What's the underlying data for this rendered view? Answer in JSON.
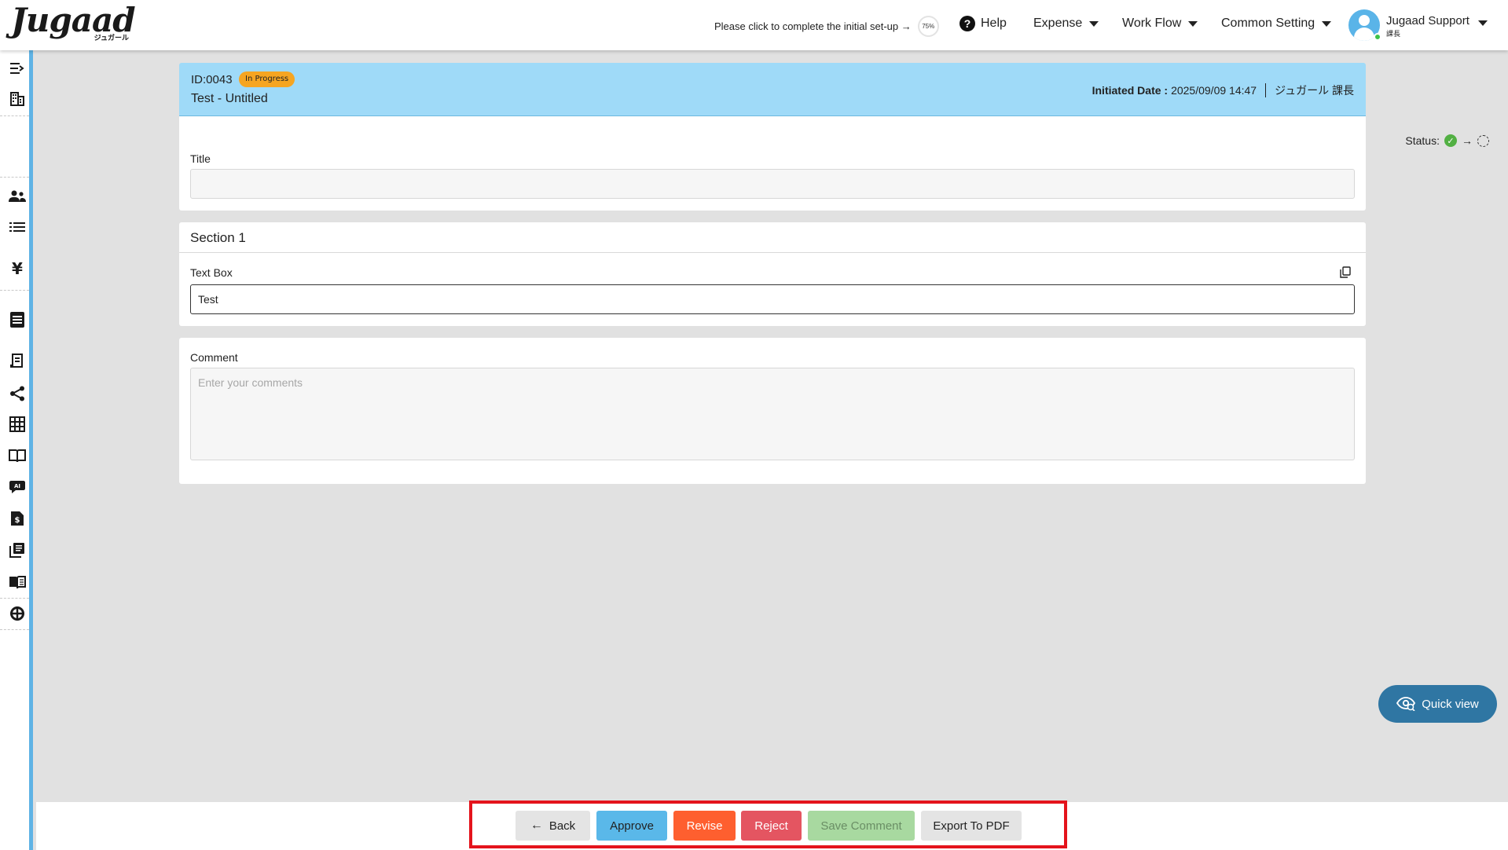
{
  "header": {
    "logo_text": "Jugaad",
    "logo_sub": "ジュガール",
    "setup_prompt": "Please click to complete the initial set-up →",
    "setup_progress": "75%",
    "help_label": "Help",
    "menus": [
      "Expense",
      "Work Flow",
      "Common Setting"
    ],
    "user_name": "Jugaad Support",
    "user_role": "課長"
  },
  "sidebar": {
    "icons": [
      "expand-sidebar-icon",
      "building-icon",
      "users-icon",
      "list-icon",
      "yen-icon",
      "document-icon",
      "receipt-icon",
      "share-icon",
      "grid-icon",
      "book-icon",
      "ai-chat-icon",
      "invoice-icon",
      "library-icon",
      "manual-icon",
      "support-icon"
    ]
  },
  "request": {
    "id": "ID:0043",
    "status_badge": "In Progress",
    "title": "Test - Untitled",
    "initiated_label": "Initiated Date :",
    "initiated_date": "2025/09/09 14:47",
    "initiator": "ジュガール 課長",
    "status_label": "Status:"
  },
  "form": {
    "title_label": "Title",
    "title_value": "",
    "section_title": "Section 1",
    "textbox_label": "Text Box",
    "textbox_value": "Test",
    "comment_label": "Comment",
    "comment_placeholder": "Enter your comments"
  },
  "quick_view_label": "Quick view",
  "actions": {
    "back": "Back",
    "approve": "Approve",
    "revise": "Revise",
    "reject": "Reject",
    "save_comment": "Save Comment",
    "export_pdf": "Export To PDF"
  },
  "colors": {
    "accent_blue": "#5ab8e9",
    "header_band": "#9fdaf8",
    "badge_orange": "#f6a521",
    "revise": "#fe5f2f",
    "reject": "#e45561",
    "save_disabled": "#a8d9a0",
    "highlight_frame": "#e4141c"
  }
}
